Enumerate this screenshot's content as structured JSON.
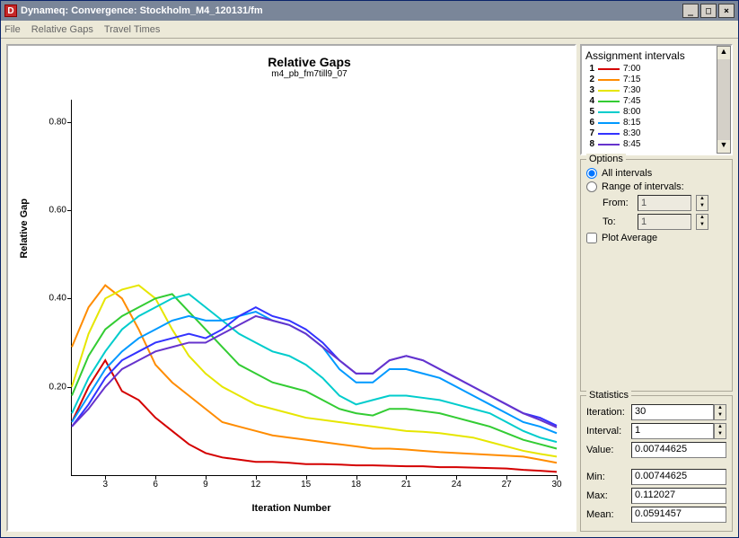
{
  "window": {
    "title": "Dynameq: Convergence: Stockholm_M4_120131/fm"
  },
  "menu": {
    "file": "File",
    "relgaps": "Relative Gaps",
    "travel": "Travel Times"
  },
  "chart_data": {
    "type": "line",
    "title": "Relative Gaps",
    "subtitle": "m4_pb_fm7till9_07",
    "xlabel": "Iteration Number",
    "ylabel": "Relative Gap",
    "ylim": [
      0,
      0.85
    ],
    "yticks": [
      0.2,
      0.4,
      0.6,
      0.8
    ],
    "xticks": [
      3,
      6,
      9,
      12,
      15,
      18,
      21,
      24,
      27,
      30
    ],
    "x": [
      1,
      2,
      3,
      4,
      5,
      6,
      7,
      8,
      9,
      10,
      11,
      12,
      13,
      14,
      15,
      16,
      17,
      18,
      19,
      20,
      21,
      22,
      23,
      24,
      25,
      26,
      27,
      28,
      29,
      30
    ],
    "series": [
      {
        "name": "7:00",
        "color": "#d40000",
        "values": [
          0.12,
          0.2,
          0.26,
          0.19,
          0.17,
          0.13,
          0.1,
          0.07,
          0.05,
          0.04,
          0.035,
          0.03,
          0.03,
          0.028,
          0.025,
          0.025,
          0.024,
          0.022,
          0.022,
          0.021,
          0.02,
          0.02,
          0.018,
          0.018,
          0.017,
          0.016,
          0.015,
          0.012,
          0.01,
          0.0074
        ]
      },
      {
        "name": "7:15",
        "color": "#ff8c00",
        "values": [
          0.29,
          0.38,
          0.43,
          0.4,
          0.33,
          0.25,
          0.21,
          0.18,
          0.15,
          0.12,
          0.11,
          0.1,
          0.09,
          0.085,
          0.08,
          0.075,
          0.07,
          0.065,
          0.06,
          0.06,
          0.058,
          0.055,
          0.052,
          0.05,
          0.048,
          0.046,
          0.044,
          0.042,
          0.035,
          0.028
        ]
      },
      {
        "name": "7:30",
        "color": "#e6e600",
        "values": [
          0.2,
          0.32,
          0.4,
          0.42,
          0.43,
          0.4,
          0.33,
          0.27,
          0.23,
          0.2,
          0.18,
          0.16,
          0.15,
          0.14,
          0.13,
          0.125,
          0.12,
          0.115,
          0.11,
          0.105,
          0.1,
          0.098,
          0.095,
          0.09,
          0.085,
          0.075,
          0.065,
          0.055,
          0.048,
          0.042
        ]
      },
      {
        "name": "7:45",
        "color": "#33cc33",
        "values": [
          0.18,
          0.27,
          0.33,
          0.36,
          0.38,
          0.4,
          0.41,
          0.37,
          0.33,
          0.29,
          0.25,
          0.23,
          0.21,
          0.2,
          0.19,
          0.17,
          0.15,
          0.14,
          0.135,
          0.15,
          0.15,
          0.145,
          0.14,
          0.13,
          0.12,
          0.11,
          0.095,
          0.08,
          0.07,
          0.06
        ]
      },
      {
        "name": "8:00",
        "color": "#00cccc",
        "values": [
          0.14,
          0.22,
          0.28,
          0.33,
          0.36,
          0.38,
          0.4,
          0.41,
          0.38,
          0.35,
          0.32,
          0.3,
          0.28,
          0.27,
          0.25,
          0.22,
          0.18,
          0.16,
          0.17,
          0.18,
          0.18,
          0.175,
          0.17,
          0.16,
          0.15,
          0.14,
          0.12,
          0.1,
          0.085,
          0.075
        ]
      },
      {
        "name": "8:15",
        "color": "#0099ff",
        "values": [
          0.12,
          0.18,
          0.24,
          0.28,
          0.31,
          0.33,
          0.35,
          0.36,
          0.35,
          0.35,
          0.36,
          0.37,
          0.35,
          0.34,
          0.32,
          0.29,
          0.24,
          0.21,
          0.21,
          0.24,
          0.24,
          0.23,
          0.22,
          0.2,
          0.18,
          0.16,
          0.14,
          0.12,
          0.11,
          0.095
        ]
      },
      {
        "name": "8:30",
        "color": "#3333ff",
        "values": [
          0.11,
          0.16,
          0.22,
          0.26,
          0.28,
          0.3,
          0.31,
          0.32,
          0.31,
          0.33,
          0.36,
          0.38,
          0.36,
          0.35,
          0.33,
          0.3,
          0.26,
          0.23,
          0.23,
          0.26,
          0.27,
          0.26,
          0.24,
          0.22,
          0.2,
          0.18,
          0.16,
          0.14,
          0.13,
          0.112
        ]
      },
      {
        "name": "8:45",
        "color": "#6633cc",
        "values": [
          0.11,
          0.15,
          0.2,
          0.24,
          0.26,
          0.28,
          0.29,
          0.3,
          0.3,
          0.32,
          0.34,
          0.36,
          0.35,
          0.34,
          0.32,
          0.29,
          0.26,
          0.23,
          0.23,
          0.26,
          0.27,
          0.26,
          0.24,
          0.22,
          0.2,
          0.18,
          0.16,
          0.14,
          0.125,
          0.108
        ]
      }
    ]
  },
  "legend": {
    "heading": "Assignment intervals",
    "items": [
      {
        "n": "1",
        "label": "7:00",
        "color": "#d40000"
      },
      {
        "n": "2",
        "label": "7:15",
        "color": "#ff8c00"
      },
      {
        "n": "3",
        "label": "7:30",
        "color": "#e6e600"
      },
      {
        "n": "4",
        "label": "7:45",
        "color": "#33cc33"
      },
      {
        "n": "5",
        "label": "8:00",
        "color": "#00cccc"
      },
      {
        "n": "6",
        "label": "8:15",
        "color": "#0099ff"
      },
      {
        "n": "7",
        "label": "8:30",
        "color": "#3333ff"
      },
      {
        "n": "8",
        "label": "8:45",
        "color": "#6633cc"
      }
    ]
  },
  "options": {
    "heading": "Options",
    "all": "All intervals",
    "range": "Range of intervals:",
    "from": "From:",
    "to": "To:",
    "from_val": "1",
    "to_val": "1",
    "plotavg": "Plot Average"
  },
  "stats": {
    "heading": "Statistics",
    "iteration_l": "Iteration:",
    "interval_l": "Interval:",
    "value_l": "Value:",
    "min_l": "Min:",
    "max_l": "Max:",
    "mean_l": "Mean:",
    "iteration": "30",
    "interval": "1",
    "value": "0.00744625",
    "min": "0.00744625",
    "max": "0.112027",
    "mean": "0.0591457"
  }
}
